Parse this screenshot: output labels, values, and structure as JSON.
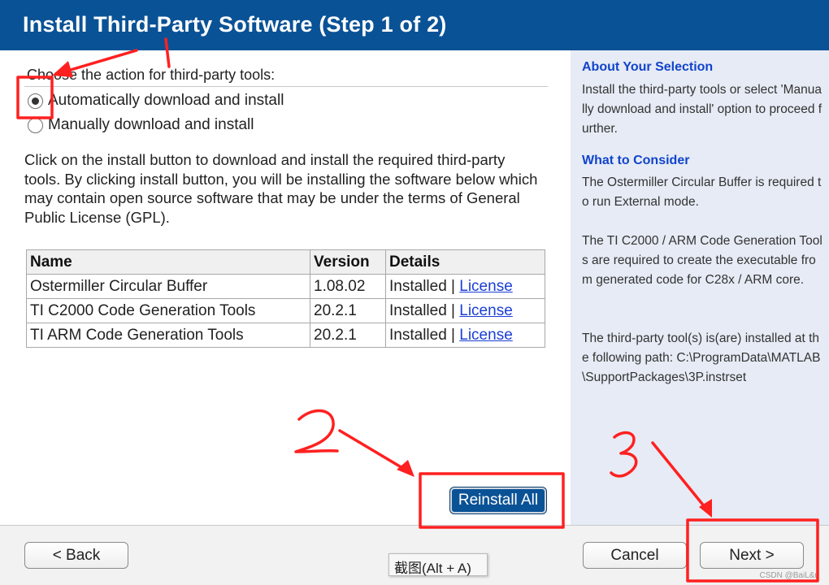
{
  "header": {
    "title": "Install Third-Party Software (Step 1 of 2)"
  },
  "main": {
    "prompt": "Choose the action for third-party tools:",
    "options": [
      {
        "label": "Automatically download and install",
        "checked": true
      },
      {
        "label": "Manually download and install",
        "checked": false
      }
    ],
    "description": "Click on the install button to download and install the required third-party tools. By clicking install button, you will be installing the software below which may contain open source software that may be under the terms of General Public License (GPL).",
    "table": {
      "headers": [
        "Name",
        "Version",
        "Details"
      ],
      "rows": [
        {
          "name": "Ostermiller Circular Buffer",
          "version": "1.08.02",
          "status": "Installed |",
          "link": "License"
        },
        {
          "name": "TI C2000 Code Generation Tools",
          "version": "20.2.1",
          "status": "Installed |",
          "link": "License"
        },
        {
          "name": "TI ARM Code Generation Tools",
          "version": "20.2.1",
          "status": "Installed |",
          "link": "License"
        }
      ]
    },
    "reinstall_label": "Reinstall All"
  },
  "side": {
    "about_title": "About Your Selection",
    "about_text": "Install the third-party tools or select 'Manually download and install' option to proceed further.",
    "consider_title": "What to Consider",
    "consider_p1": "The Ostermiller Circular Buffer is required to run External mode.",
    "consider_p2": "The TI C2000 / ARM Code Generation Tools are required to create the executable from generated code for C28x / ARM core.",
    "consider_p3": "The third-party tool(s) is(are) installed at the following path: C:\\ProgramData\\MATLAB\\SupportPackages\\3P.instrset"
  },
  "footer": {
    "back_label": "< Back",
    "cancel_label": "Cancel",
    "next_label": "Next >",
    "tooltip": "截图(Alt + A)",
    "watermark": "CSDN @BaiL&u"
  },
  "colors": {
    "header": "#0a5296",
    "sidebar": "#e6ebf5",
    "annotation": "#ff2020",
    "link": "#1a3fd6"
  }
}
